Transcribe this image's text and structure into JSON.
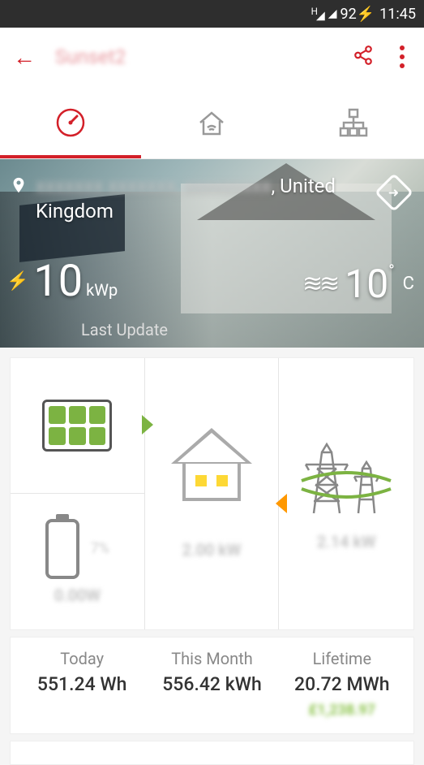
{
  "status": {
    "signal_badge": "H",
    "battery": "92",
    "time": "11:45"
  },
  "header": {
    "title": "Sunset2"
  },
  "hero": {
    "location_prefix_hidden": "xxxxxxx xxxxxxx, xxxxxxxxx",
    "location_suffix": ", United Kingdom",
    "power_value": "10",
    "power_unit": "kWp",
    "temp_value": "10",
    "temp_unit": "C",
    "last_update_label": "Last Update"
  },
  "flow": {
    "battery_pct": "7%",
    "solar_val": "0.00W",
    "house_val": "2.00 kW",
    "grid_val": "2.14 kW"
  },
  "stats": {
    "today_label": "Today",
    "today_value": "551.24  Wh",
    "month_label": "This Month",
    "month_value": "556.42 kWh",
    "life_label": "Lifetime",
    "life_value": "20.72 MWh",
    "life_extra": "£1,238.97"
  }
}
